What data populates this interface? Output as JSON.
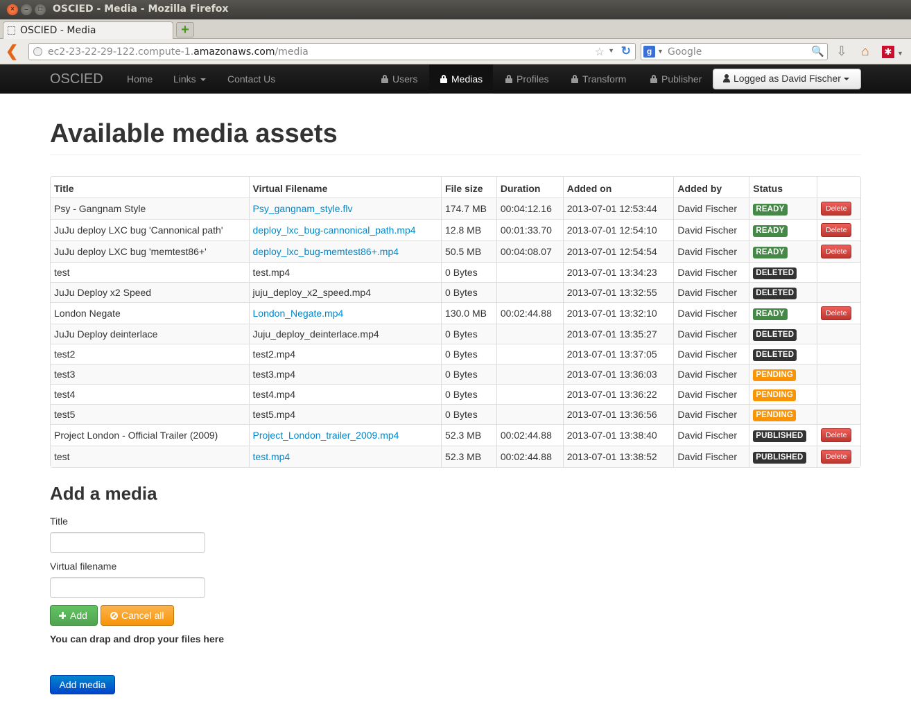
{
  "window": {
    "title": "OSCIED - Media - Mozilla Firefox",
    "tab_label": "OSCIED - Media",
    "url_prefix": "ec2-23-22-29-122.compute-1.",
    "url_domain": "amazonaws.com",
    "url_path": "/media",
    "search_placeholder": "Google"
  },
  "nav": {
    "brand": "OSCIED",
    "home": "Home",
    "links": "Links",
    "contact": "Contact Us",
    "users": "Users",
    "medias": "Medias",
    "profiles": "Profiles",
    "transform": "Transform",
    "publisher": "Publisher",
    "logged_as": "Logged as David Fischer"
  },
  "page": {
    "title": "Available media assets"
  },
  "table": {
    "headers": [
      "Title",
      "Virtual Filename",
      "File size",
      "Duration",
      "Added on",
      "Added by",
      "Status",
      ""
    ],
    "rows": [
      {
        "title": "Psy - Gangnam Style",
        "filename": "Psy_gangnam_style.flv",
        "size": "174.7 MB",
        "duration": "00:04:12.16",
        "added_on": "2013-07-01 12:53:44",
        "added_by": "David Fischer",
        "status": "READY",
        "delete": "Delete"
      },
      {
        "title": "JuJu deploy LXC bug 'Cannonical path'",
        "filename": "deploy_lxc_bug-cannonical_path.mp4",
        "size": "12.8 MB",
        "duration": "00:01:33.70",
        "added_on": "2013-07-01 12:54:10",
        "added_by": "David Fischer",
        "status": "READY",
        "delete": "Delete"
      },
      {
        "title": "JuJu deploy LXC bug 'memtest86+'",
        "filename": "deploy_lxc_bug-memtest86+.mp4",
        "size": "50.5 MB",
        "duration": "00:04:08.07",
        "added_on": "2013-07-01 12:54:54",
        "added_by": "David Fischer",
        "status": "READY",
        "delete": "Delete"
      },
      {
        "title": "test",
        "filename": "test.mp4",
        "size": "0 Bytes",
        "duration": "",
        "added_on": "2013-07-01 13:34:23",
        "added_by": "David Fischer",
        "status": "DELETED",
        "delete": ""
      },
      {
        "title": "JuJu Deploy x2 Speed",
        "filename": "juju_deploy_x2_speed.mp4",
        "size": "0 Bytes",
        "duration": "",
        "added_on": "2013-07-01 13:32:55",
        "added_by": "David Fischer",
        "status": "DELETED",
        "delete": ""
      },
      {
        "title": "London Negate",
        "filename": "London_Negate.mp4",
        "size": "130.0 MB",
        "duration": "00:02:44.88",
        "added_on": "2013-07-01 13:32:10",
        "added_by": "David Fischer",
        "status": "READY",
        "delete": "Delete"
      },
      {
        "title": "JuJu Deploy deinterlace",
        "filename": "Juju_deploy_deinterlace.mp4",
        "size": "0 Bytes",
        "duration": "",
        "added_on": "2013-07-01 13:35:27",
        "added_by": "David Fischer",
        "status": "DELETED",
        "delete": ""
      },
      {
        "title": "test2",
        "filename": "test2.mp4",
        "size": "0 Bytes",
        "duration": "",
        "added_on": "2013-07-01 13:37:05",
        "added_by": "David Fischer",
        "status": "DELETED",
        "delete": ""
      },
      {
        "title": "test3",
        "filename": "test3.mp4",
        "size": "0 Bytes",
        "duration": "",
        "added_on": "2013-07-01 13:36:03",
        "added_by": "David Fischer",
        "status": "PENDING",
        "delete": ""
      },
      {
        "title": "test4",
        "filename": "test4.mp4",
        "size": "0 Bytes",
        "duration": "",
        "added_on": "2013-07-01 13:36:22",
        "added_by": "David Fischer",
        "status": "PENDING",
        "delete": ""
      },
      {
        "title": "test5",
        "filename": "test5.mp4",
        "size": "0 Bytes",
        "duration": "",
        "added_on": "2013-07-01 13:36:56",
        "added_by": "David Fischer",
        "status": "PENDING",
        "delete": ""
      },
      {
        "title": "Project London - Official Trailer (2009)",
        "filename": "Project_London_trailer_2009.mp4",
        "size": "52.3 MB",
        "duration": "00:02:44.88",
        "added_on": "2013-07-01 13:38:40",
        "added_by": "David Fischer",
        "status": "PUBLISHED",
        "delete": "Delete"
      },
      {
        "title": "test",
        "filename": "test.mp4",
        "size": "52.3 MB",
        "duration": "00:02:44.88",
        "added_on": "2013-07-01 13:38:52",
        "added_by": "David Fischer",
        "status": "PUBLISHED",
        "delete": "Delete"
      }
    ]
  },
  "status_colors": {
    "READY": "#468847",
    "DELETED": "#333333",
    "PENDING": "#f89406",
    "PUBLISHED": "#333333"
  },
  "form": {
    "heading": "Add a media",
    "title_label": "Title",
    "title_value": "",
    "filename_label": "Virtual filename",
    "filename_value": "",
    "add_button": "Add",
    "cancel_button": "Cancel all",
    "dnd_text": "You can drap and drop your files here",
    "submit_button": "Add media"
  }
}
